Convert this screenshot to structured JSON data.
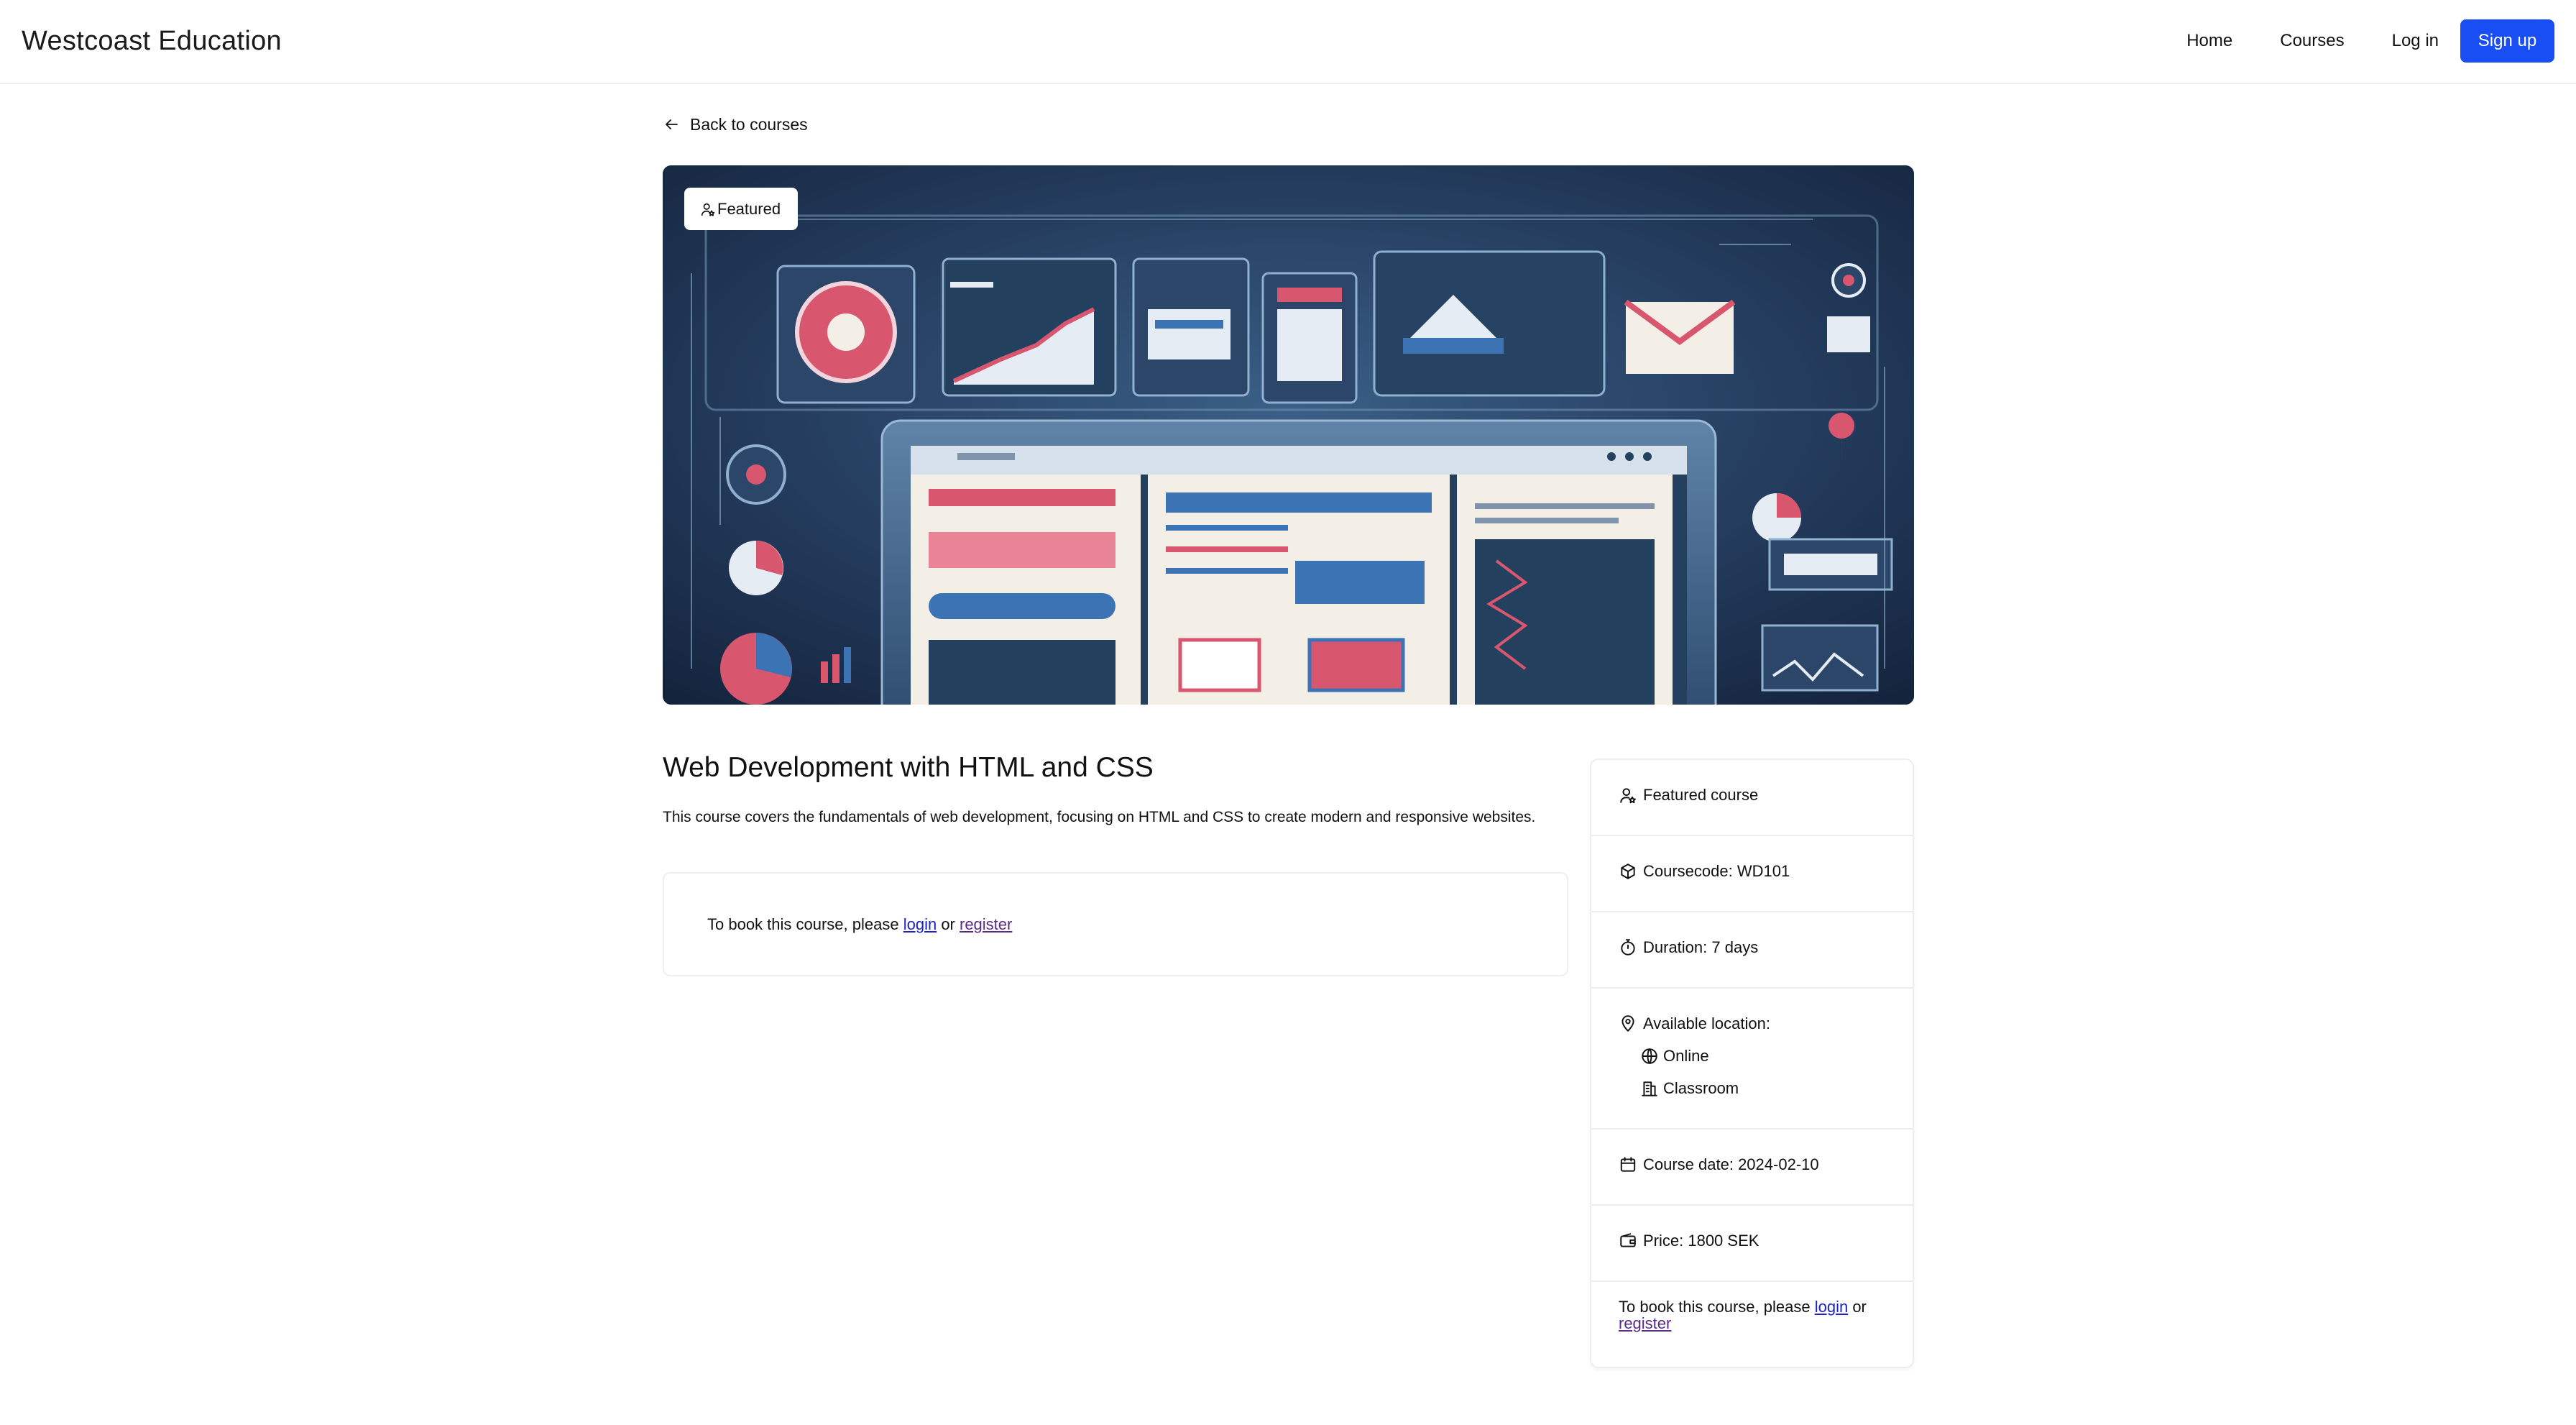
{
  "navbar": {
    "brand": "Westcoast Education",
    "links": {
      "home": "Home",
      "courses": "Courses",
      "login": "Log in"
    },
    "signup": "Sign up",
    "accent_color": "#1a4ef5"
  },
  "back_link": {
    "label": "Back to courses",
    "icon": "arrow-left-icon"
  },
  "hero": {
    "badge": "Featured",
    "badge_icon": "user-star-icon",
    "image": "web-development-illustration"
  },
  "course": {
    "title": "Web Development with HTML and CSS",
    "description": "This course covers the fundamentals of web development, focusing on HTML and CSS to create modern and responsive websites."
  },
  "booking": {
    "prefix": "To book this course, please ",
    "login": "login",
    "or": " or ",
    "register": "register"
  },
  "details": {
    "featured": "Featured course",
    "coursecode": "Coursecode: WD101",
    "duration": "Duration: 7 days",
    "location_label": "Available location:",
    "locations": [
      "Online",
      "Classroom"
    ],
    "date": "Course date: 2024-02-10",
    "price": "Price: 1800 SEK",
    "booking_prefix": "To book this course, please ",
    "booking_login": "login",
    "booking_or": " or",
    "booking_register": "register"
  }
}
